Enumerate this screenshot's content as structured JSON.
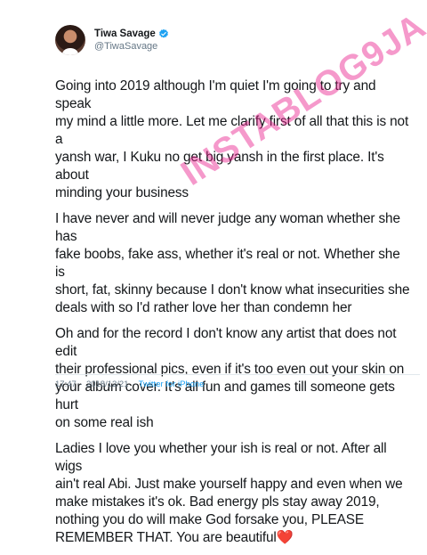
{
  "tweet": {
    "display_name": "Tiwa Savage",
    "handle": "@TiwaSavage",
    "paragraphs": [
      "Going into 2019 although I'm quiet I'm going to try and speak\nmy mind a little more. Let me clarify first of all that this is not a\nyansh war, I Kuku no get big yansh in the first place. It's about\nminding your business",
      "I have never and will never judge any woman whether she has\nfake boobs, fake ass, whether it's real or not. Whether she is\nshort, fat, skinny because I don't know what insecurities she\ndeals with so I'd rather love her than condemn her",
      "Oh and for the record I don't know any artist that does not edit\ntheir professional pics, even if it's too even out your skin on\nyour album cover. It's all fun and games till someone gets hurt\non some real ish",
      "Ladies I love you whether your ish is real or not. After all wigs\nain't real Abi. Just make yourself happy and even when we\nmake mistakes it's ok. Bad energy pls stay away 2019,\nnothing you do will make God forsake you, PLEASE\nREMEMBER THAT. You are beautiful"
    ],
    "heart": "❤️",
    "time": "17:47",
    "date": "2018/12/21",
    "separator": "·",
    "source": "Twitter for iPhone"
  },
  "watermark": "INSTABLOG9JA",
  "colors": {
    "verified": "#1da1f2",
    "link": "#1da1f2",
    "heart": "#e0245e",
    "watermark": "#e81c8c"
  },
  "icons": {
    "verified": "verified-badge-icon"
  }
}
